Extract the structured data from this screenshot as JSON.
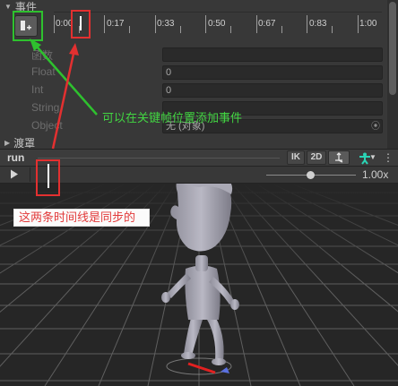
{
  "inspector": {
    "events_header": "事件",
    "curves_header": "渡罩",
    "timeline_ticks": [
      "0:00",
      "0:17",
      "0:33",
      "0:50",
      "0:67",
      "0:83",
      "1:00"
    ],
    "fields": [
      {
        "label": "函数",
        "value": ""
      },
      {
        "label": "Float",
        "value": "0"
      },
      {
        "label": "Int",
        "value": "0"
      },
      {
        "label": "String",
        "value": ""
      },
      {
        "label": "Object",
        "value": "无 (对象)"
      }
    ]
  },
  "preview": {
    "clip_name": "run",
    "ik_label": "IK",
    "mode_2d_label": "2D",
    "speed_value": "1.00x",
    "speed_fraction": 0.5
  },
  "annotations": {
    "green_note": "可以在关键帧位置添加事件",
    "red_note": "这两条时间线是同步的"
  },
  "colors": {
    "annotation_green": "#2ec12e",
    "annotation_red": "#e33030",
    "avatar_teal": "#2ad4b5"
  }
}
